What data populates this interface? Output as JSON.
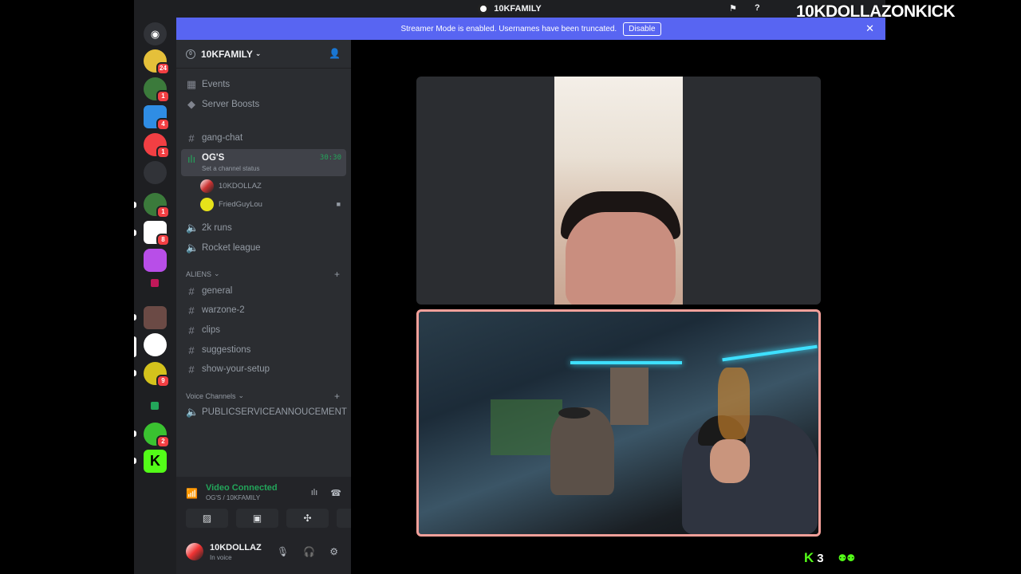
{
  "window": {
    "title": "10KFAMILY"
  },
  "overlay": {
    "brand_text": "10KDOLLAZONKICK",
    "viewer_count": "3"
  },
  "banner": {
    "message": "Streamer Mode is enabled. Usernames have been truncated.",
    "disable_label": "Disable"
  },
  "guild_badges": [
    "24",
    "1",
    "4",
    "1",
    "1",
    "8",
    "9",
    "2"
  ],
  "server": {
    "name": "10KFAMILY",
    "boost_level": "0"
  },
  "top_items": [
    {
      "label": "Events",
      "icon": "calendar-icon"
    },
    {
      "label": "Server Boosts",
      "icon": "boost-icon"
    }
  ],
  "channels": {
    "gang_chat": "gang-chat",
    "active_voice": {
      "name": "OG'S",
      "status": "Set a channel status",
      "timer": "30:30"
    },
    "voice_users": [
      "10KDOLLAZ",
      "FriedGuyLou"
    ],
    "voice_others": [
      "2k runs",
      "Rocket league"
    ],
    "category_aliens": "ALIENS",
    "aliens_channels": [
      "general",
      "warzone-2",
      "clips",
      "suggestions",
      "show-your-setup"
    ],
    "category_voice": "Voice Channels",
    "voice_channels": [
      "PUBLICSERVICEANNOUCEMENT"
    ]
  },
  "voice_panel": {
    "title": "Video Connected",
    "subtitle": "OG'S / 10KFAMILY"
  },
  "user": {
    "name": "10KDOLLAZ",
    "status": "In voice"
  },
  "colors": {
    "accent": "#5865f2",
    "green": "#23a55a",
    "kick": "#53fc18"
  }
}
